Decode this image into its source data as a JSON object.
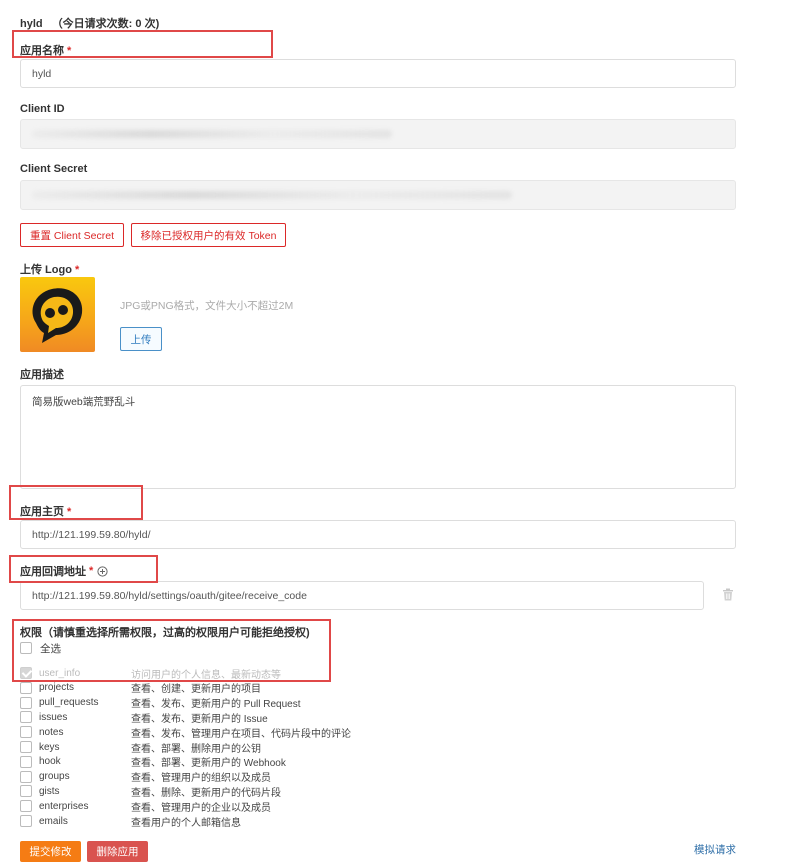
{
  "header": {
    "app_name": "hyld",
    "request_count": "（今日请求次数: 0 次)"
  },
  "form": {
    "app_name_label": "应用名称",
    "required_mark": "*",
    "app_name_value": "hyld",
    "client_id_label": "Client ID",
    "client_secret_label": "Client Secret",
    "reset_secret_button": "重置 Client Secret",
    "revoke_tokens_button": "移除已授权用户的有效 Token",
    "logo_label": "上传 Logo",
    "logo_hint": "JPG或PNG格式，文件大小不超过2M",
    "upload_button": "上传",
    "description_label": "应用描述",
    "description_value": "简易版web端荒野乱斗",
    "homepage_label": "应用主页",
    "homepage_value": "http://121.199.59.80/hyld/",
    "callback_label": "应用回调地址",
    "callback_value": "http://121.199.59.80/hyld/settings/oauth/gitee/receive_code"
  },
  "permissions": {
    "label": "权限（请慎重选择所需权限，过高的权限用户可能拒绝授权)",
    "select_all": "全选",
    "scopes": [
      {
        "name": "user_info",
        "desc": "访问用户的个人信息、最新动态等",
        "checked": true,
        "disabled": true
      },
      {
        "name": "projects",
        "desc": "查看、创建、更新用户的项目",
        "checked": false,
        "disabled": false
      },
      {
        "name": "pull_requests",
        "desc": "查看、发布、更新用户的 Pull Request",
        "checked": false,
        "disabled": false
      },
      {
        "name": "issues",
        "desc": "查看、发布、更新用户的 Issue",
        "checked": false,
        "disabled": false
      },
      {
        "name": "notes",
        "desc": "查看、发布、管理用户在项目、代码片段中的评论",
        "checked": false,
        "disabled": false
      },
      {
        "name": "keys",
        "desc": "查看、部署、删除用户的公钥",
        "checked": false,
        "disabled": false
      },
      {
        "name": "hook",
        "desc": "查看、部署、更新用户的 Webhook",
        "checked": false,
        "disabled": false
      },
      {
        "name": "groups",
        "desc": "查看、管理用户的组织以及成员",
        "checked": false,
        "disabled": false
      },
      {
        "name": "gists",
        "desc": "查看、删除、更新用户的代码片段",
        "checked": false,
        "disabled": false
      },
      {
        "name": "enterprises",
        "desc": "查看、管理用户的企业以及成员",
        "checked": false,
        "disabled": false
      },
      {
        "name": "emails",
        "desc": "查看用户的个人邮箱信息",
        "checked": false,
        "disabled": false
      }
    ]
  },
  "actions": {
    "submit_button": "提交修改",
    "delete_button": "删除应用",
    "simulate_link": "模拟请求"
  },
  "colors": {
    "accent_red": "#db2828",
    "submit_orange": "#f57c14",
    "delete_red": "#d9534f",
    "annotation_red": "#e04848",
    "link_blue": "#2f6fa8"
  },
  "icons": {
    "add_icon": "circle-plus-icon",
    "delete_icon": "trash-icon"
  }
}
